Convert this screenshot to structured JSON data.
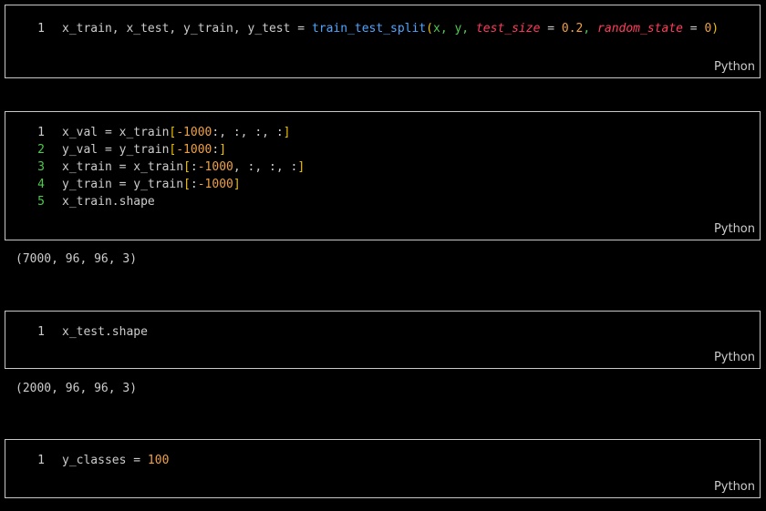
{
  "cells": [
    {
      "language": "Python",
      "lines": [
        {
          "number": "1",
          "tokens": [
            {
              "t": "x_train, x_test, y_train, y_test ",
              "c": "var"
            },
            {
              "t": "=",
              "c": "op"
            },
            {
              "t": " ",
              "c": "var"
            },
            {
              "t": "train_test_split",
              "c": "fn"
            },
            {
              "t": "(",
              "c": "par"
            },
            {
              "t": "x, y, ",
              "c": "arg"
            },
            {
              "t": "test_size",
              "c": "kw"
            },
            {
              "t": " = ",
              "c": "op"
            },
            {
              "t": "0.2",
              "c": "num"
            },
            {
              "t": ", ",
              "c": "arg"
            },
            {
              "t": "random_state",
              "c": "kw"
            },
            {
              "t": " = ",
              "c": "op"
            },
            {
              "t": "0",
              "c": "num"
            },
            {
              "t": ")",
              "c": "par"
            }
          ]
        }
      ],
      "output": ""
    },
    {
      "language": "Python",
      "lines": [
        {
          "number": "1",
          "tokens": [
            {
              "t": "x_val = x_train",
              "c": "var"
            },
            {
              "t": "[",
              "c": "par"
            },
            {
              "t": "-1000",
              "c": "num"
            },
            {
              "t": ":, :, :, :",
              "c": "var"
            },
            {
              "t": "]",
              "c": "par"
            }
          ]
        },
        {
          "number": "2",
          "tokens": [
            {
              "t": "y_val = y_train",
              "c": "var"
            },
            {
              "t": "[",
              "c": "par"
            },
            {
              "t": "-1000",
              "c": "num"
            },
            {
              "t": ":",
              "c": "var"
            },
            {
              "t": "]",
              "c": "par"
            }
          ]
        },
        {
          "number": "3",
          "tokens": [
            {
              "t": "x_train = x_train",
              "c": "var"
            },
            {
              "t": "[",
              "c": "par"
            },
            {
              "t": ":",
              "c": "var"
            },
            {
              "t": "-1000",
              "c": "num"
            },
            {
              "t": ", :, :, :",
              "c": "var"
            },
            {
              "t": "]",
              "c": "par"
            }
          ]
        },
        {
          "number": "4",
          "tokens": [
            {
              "t": "y_train = y_train",
              "c": "var"
            },
            {
              "t": "[",
              "c": "par"
            },
            {
              "t": ":",
              "c": "var"
            },
            {
              "t": "-1000",
              "c": "num"
            },
            {
              "t": "]",
              "c": "par"
            }
          ]
        },
        {
          "number": "5",
          "tokens": [
            {
              "t": "x_train.shape",
              "c": "var"
            }
          ]
        }
      ],
      "output": "(7000, 96, 96, 3)"
    },
    {
      "language": "Python",
      "lines": [
        {
          "number": "1",
          "tokens": [
            {
              "t": "x_test.shape",
              "c": "var"
            }
          ]
        }
      ],
      "output": "(2000, 96, 96, 3)"
    },
    {
      "language": "Python",
      "lines": [
        {
          "number": "1",
          "tokens": [
            {
              "t": "y_classes = ",
              "c": "var"
            },
            {
              "t": "100",
              "c": "num"
            }
          ]
        }
      ],
      "output": ""
    }
  ],
  "colors": {
    "background": "#000000",
    "border": "#c8c8c8",
    "text": "#cccccc",
    "function": "#4fa6ff",
    "paren": "#f0c000",
    "argument": "#4ec94e",
    "keyword_arg": "#ff3c5a",
    "number": "#f0a040",
    "active_line_number": "#4ec94e"
  }
}
